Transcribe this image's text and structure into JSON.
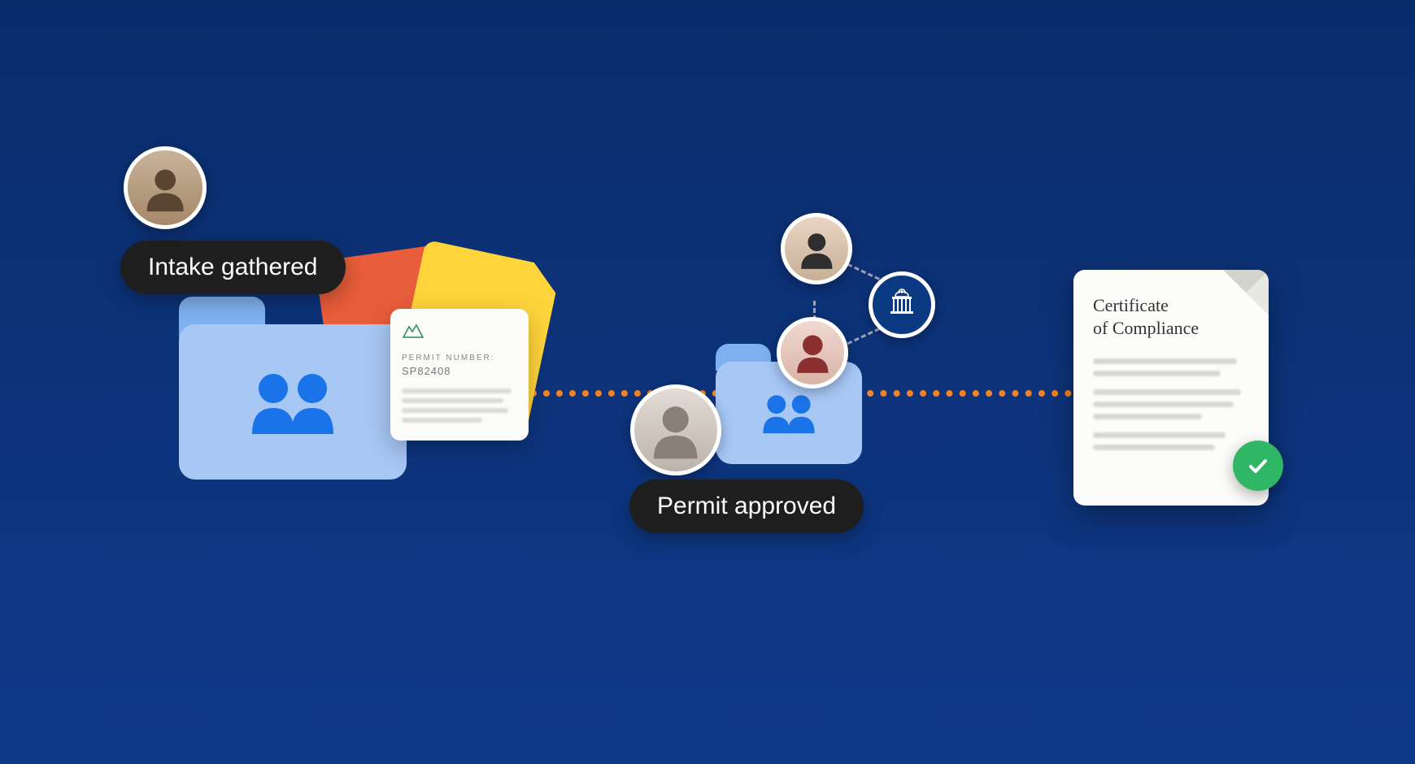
{
  "colors": {
    "background_top": "#0a2c6b",
    "background_bottom": "#0f3a8a",
    "pill_bg": "#1e1e1e",
    "pill_text": "#ffffff",
    "folder_light": "#a7c7f5",
    "folder_dark": "#7fb0ef",
    "people_icon": "#1a73e8",
    "connector": "#f58220",
    "check_bg": "#2fb765",
    "doc_orange": "#e85d3a",
    "doc_yellow": "#ffd43b",
    "gov_bg": "#0c3a82"
  },
  "steps": {
    "intake": {
      "pill_label": "Intake gathered",
      "avatar_name": "applicant-avatar"
    },
    "permit": {
      "pill_label": "Permit approved",
      "avatar_name": "reviewer-avatar",
      "network_avatars": [
        "stakeholder-avatar-1",
        "stakeholder-avatar-2"
      ],
      "gov_icon": "capitol-icon"
    },
    "certificate": {
      "title_line1": "Certificate",
      "title_line2": "of Compliance",
      "check_icon": "check-icon"
    }
  },
  "permit_doc": {
    "label": "PERMIT NUMBER:",
    "number": "SP82408"
  }
}
